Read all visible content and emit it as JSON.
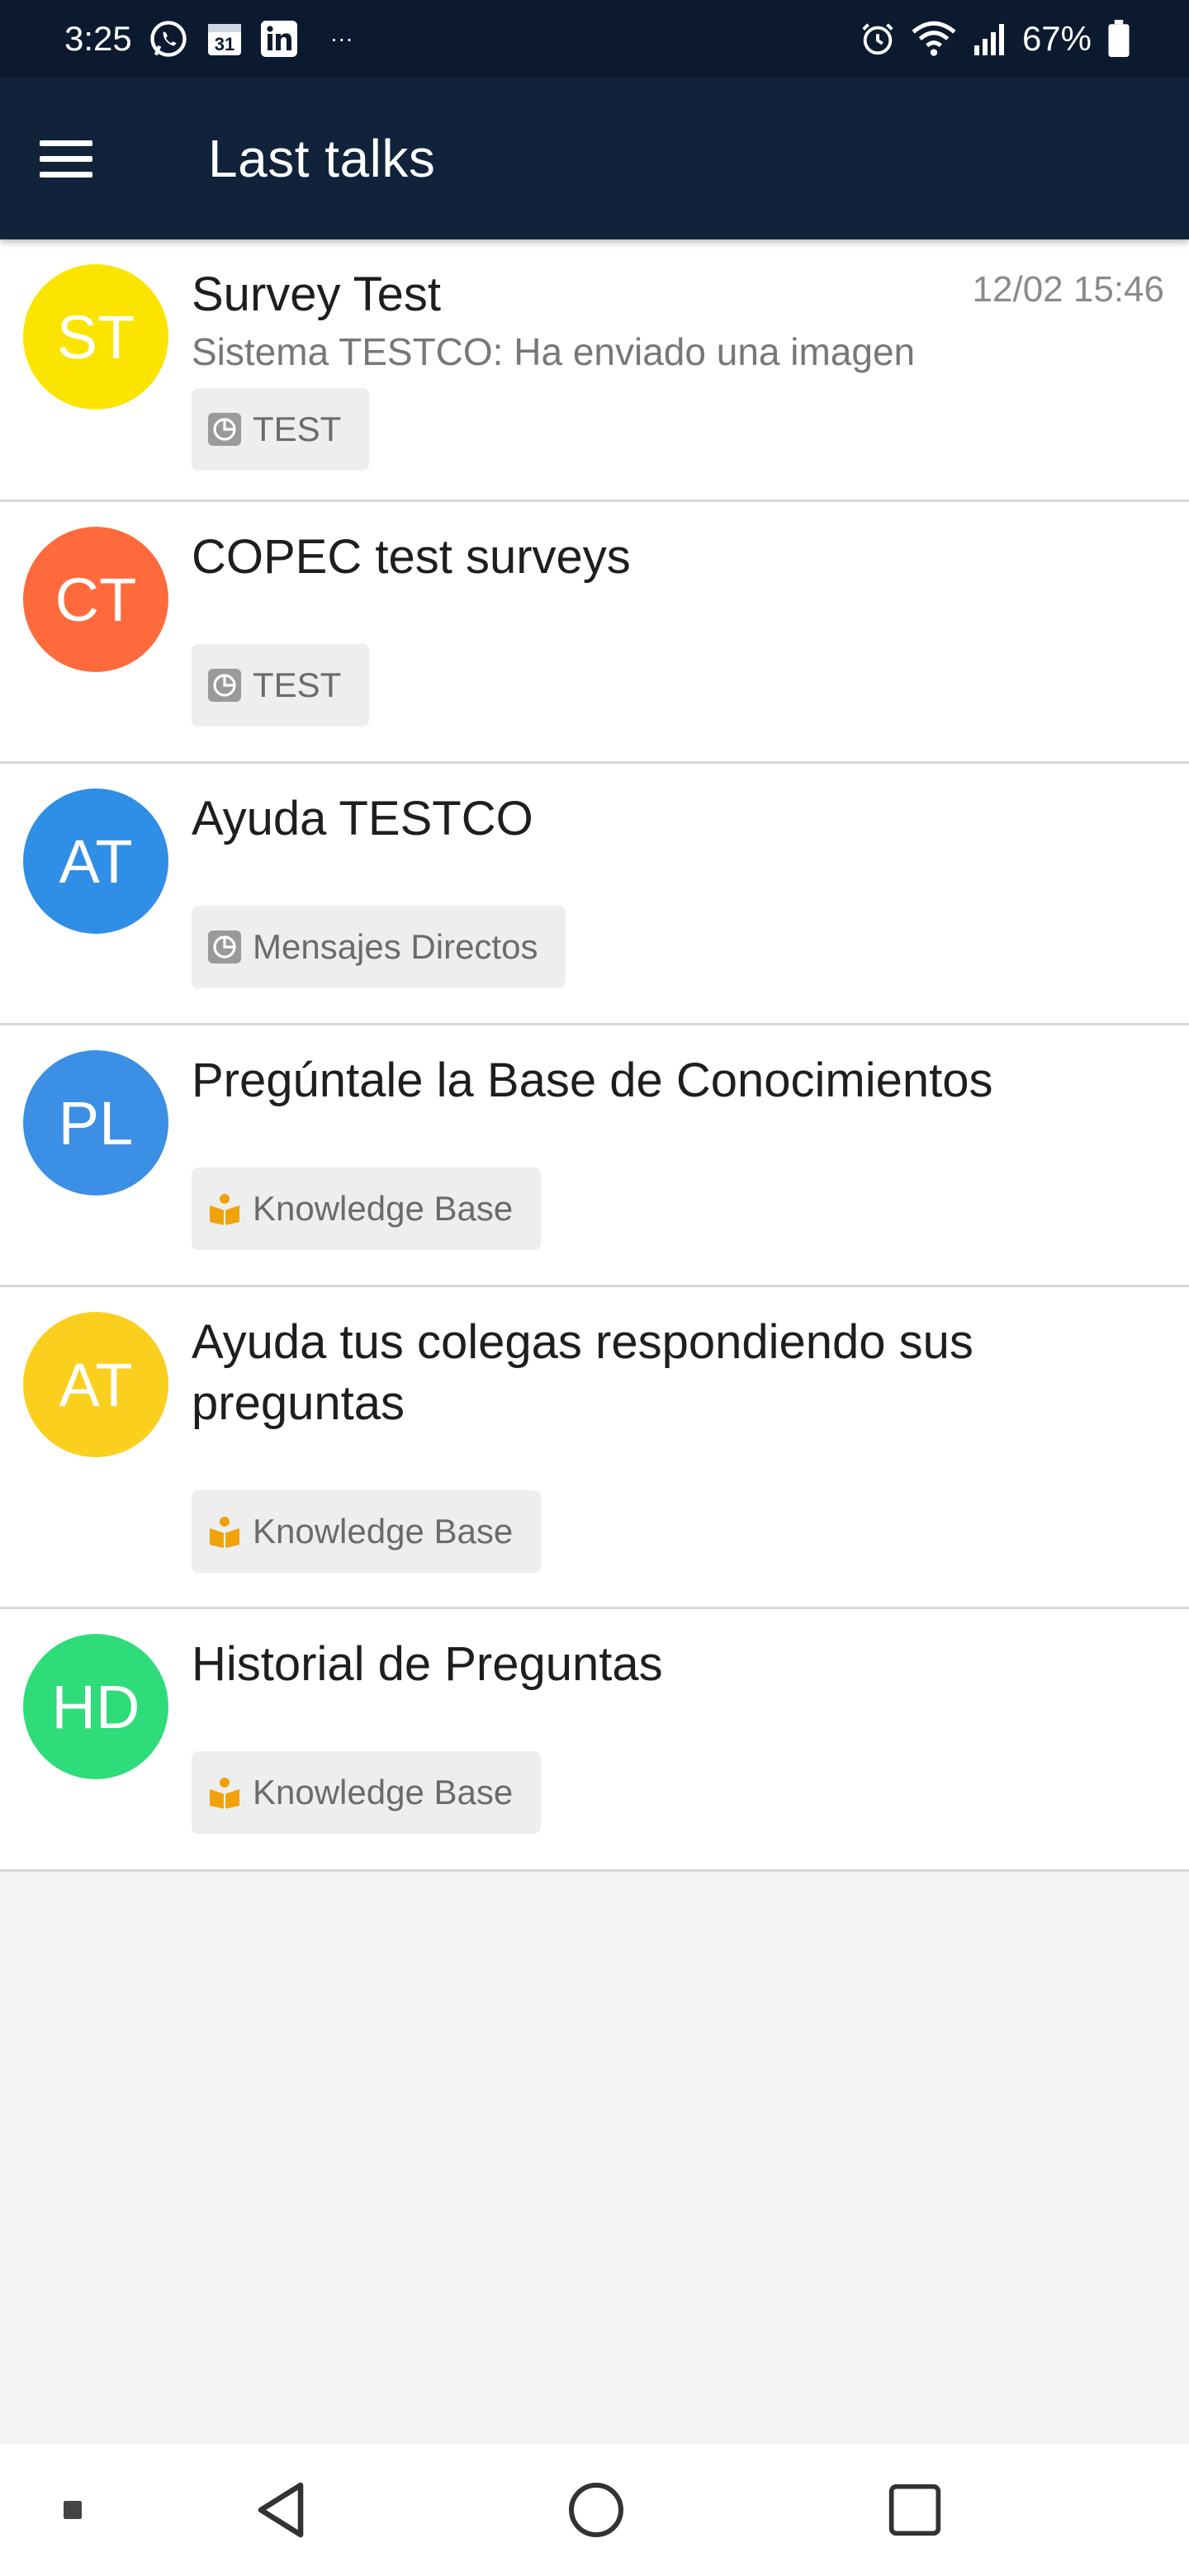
{
  "status_bar": {
    "time": "3:25",
    "calendar_day": "31",
    "overflow": "···",
    "battery": "67%"
  },
  "app_bar": {
    "title": "Last talks"
  },
  "talks": [
    {
      "initials": "ST",
      "avatar_color": "#fbe500",
      "title": "Survey Test",
      "subtitle": "Sistema TESTCO: Ha enviado una imagen",
      "timestamp": "12/02 15:46",
      "tag": "TEST",
      "tag_icon": "survey-icon"
    },
    {
      "initials": "CT",
      "avatar_color": "#ff6a3c",
      "title": "COPEC test surveys",
      "subtitle": "",
      "timestamp": "",
      "tag": "TEST",
      "tag_icon": "survey-icon"
    },
    {
      "initials": "AT",
      "avatar_color": "#2f8ee5",
      "title": "Ayuda TESTCO",
      "subtitle": "",
      "timestamp": "",
      "tag": "Mensajes Directos",
      "tag_icon": "survey-icon"
    },
    {
      "initials": "PL",
      "avatar_color": "#3b8fe4",
      "title": "Pregúntale la Base de Conocimientos",
      "subtitle": "",
      "timestamp": "",
      "tag": "Knowledge Base",
      "tag_icon": "book-icon"
    },
    {
      "initials": "AT",
      "avatar_color": "#fbcf1d",
      "title": "Ayuda tus colegas respondiendo sus preguntas",
      "subtitle": "",
      "timestamp": "",
      "tag": "Knowledge Base",
      "tag_icon": "book-icon"
    },
    {
      "initials": "HD",
      "avatar_color": "#2fdc7a",
      "title": "Historial de Preguntas",
      "subtitle": "",
      "timestamp": "",
      "tag": "Knowledge Base",
      "tag_icon": "book-icon"
    }
  ],
  "colors": {
    "app_bar": "#10233b",
    "status_bar": "#0b1a2f",
    "kb_icon": "#f0a20b",
    "survey_icon": "#9a9a9a"
  }
}
